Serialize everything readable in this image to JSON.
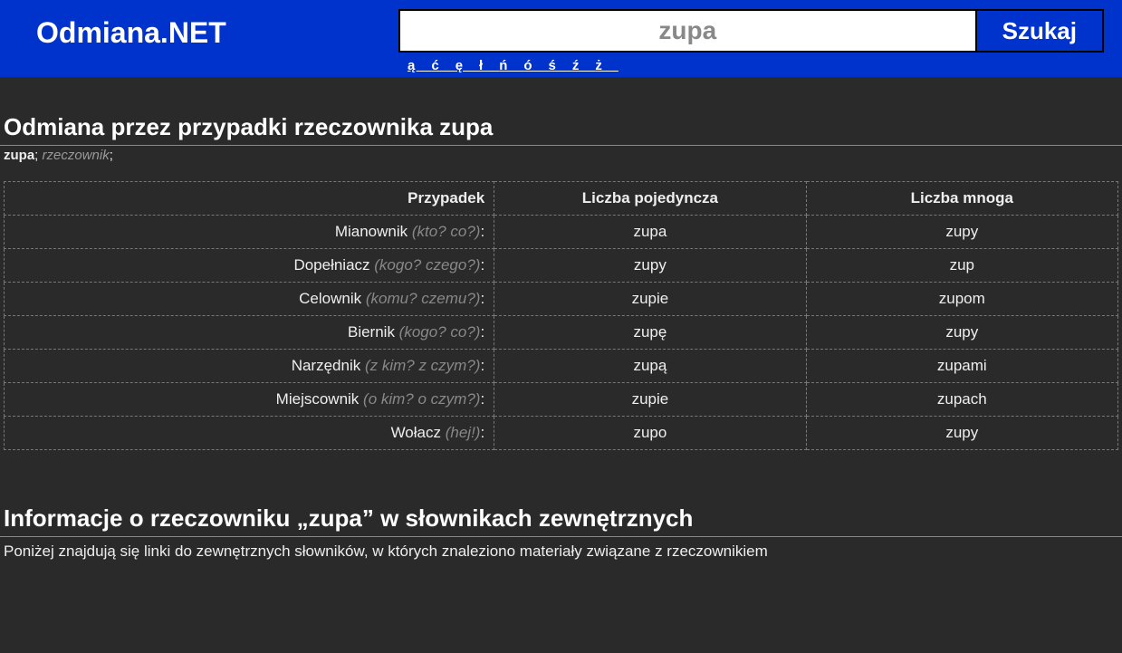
{
  "header": {
    "site_title": "Odmiana.NET",
    "search_value": "zupa",
    "search_button": "Szukaj",
    "special_chars": [
      "ą",
      "ć",
      "ę",
      "ł",
      "ń",
      "ó",
      "ś",
      "ź",
      "ż"
    ]
  },
  "main": {
    "heading": "Odmiana przez przypadki rzeczownika zupa",
    "subtitle_word": "zupa",
    "subtitle_sep1": "; ",
    "subtitle_pos": "rzeczownik",
    "subtitle_sep2": ";",
    "table": {
      "headers": {
        "case": "Przypadek",
        "singular": "Liczba pojedyncza",
        "plural": "Liczba mnoga"
      },
      "rows": [
        {
          "name": "Mianownik",
          "question": "(kto? co?)",
          "colon": ":",
          "singular": "zupa",
          "plural": "zupy"
        },
        {
          "name": "Dopełniacz",
          "question": "(kogo? czego?)",
          "colon": ":",
          "singular": "zupy",
          "plural": "zup"
        },
        {
          "name": "Celownik",
          "question": "(komu? czemu?)",
          "colon": ":",
          "singular": "zupie",
          "plural": "zupom"
        },
        {
          "name": "Biernik",
          "question": "(kogo? co?)",
          "colon": ":",
          "singular": "zupę",
          "plural": "zupy"
        },
        {
          "name": "Narzędnik",
          "question": "(z kim? z czym?)",
          "colon": ":",
          "singular": "zupą",
          "plural": "zupami"
        },
        {
          "name": "Miejscownik",
          "question": "(o kim? o czym?)",
          "colon": ":",
          "singular": "zupie",
          "plural": "zupach"
        },
        {
          "name": "Wołacz",
          "question": "(hej!)",
          "colon": ":",
          "singular": "zupo",
          "plural": "zupy"
        }
      ]
    },
    "section2_heading": "Informacje o rzeczowniku „zupa” w słownikach zewnętrznych",
    "section2_desc": "Poniżej znajdują się linki do zewnętrznych słowników, w których znaleziono materiały związane z rzeczownikiem"
  }
}
